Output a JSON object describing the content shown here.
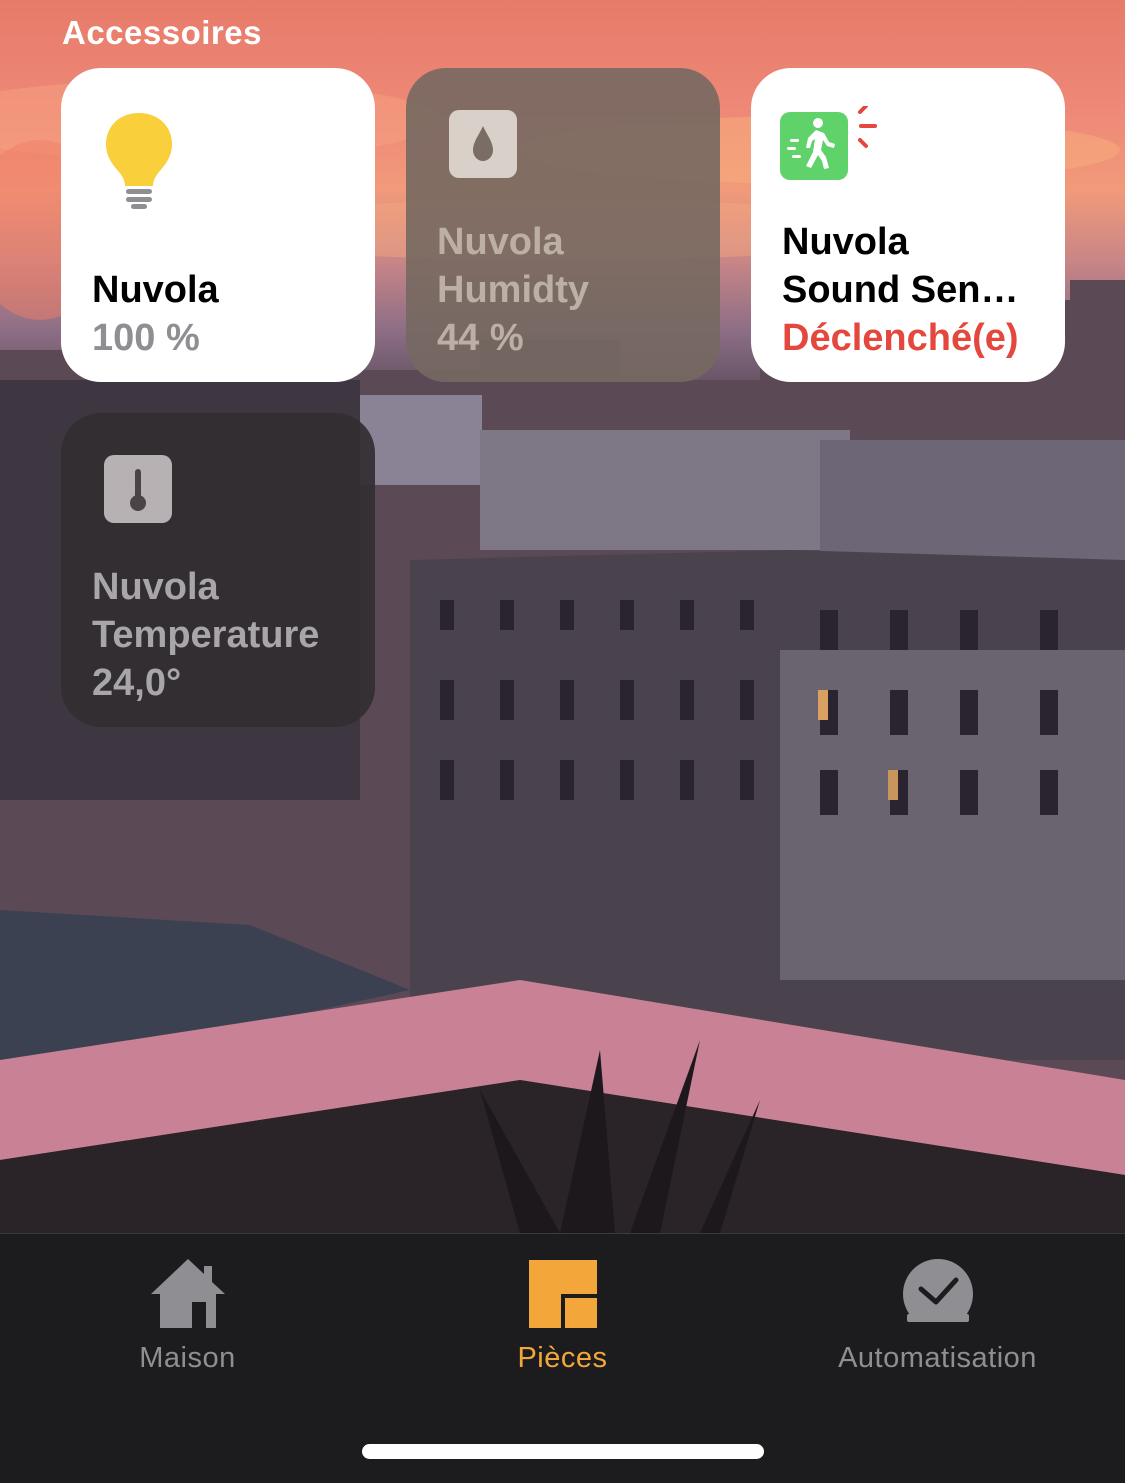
{
  "section_title": "Accessoires",
  "accessories": [
    {
      "line1": "Nuvola",
      "line2": "",
      "status": "100 %",
      "icon": "lightbulb-icon",
      "state": "on"
    },
    {
      "line1": "Nuvola",
      "line2": "Humidty",
      "status": "44 %",
      "icon": "humidity-drop-icon",
      "state": "off"
    },
    {
      "line1": "Nuvola",
      "line2": "Sound Sen…",
      "status": "Déclenché(e)",
      "icon": "motion-sensor-icon",
      "state": "triggered"
    },
    {
      "line1": "Nuvola",
      "line2": "Temperature",
      "status": "24,0°",
      "icon": "thermometer-icon",
      "state": "off"
    }
  ],
  "tabs": [
    {
      "label": "Maison",
      "icon": "house-icon",
      "active": false
    },
    {
      "label": "Pièces",
      "icon": "rooms-icon",
      "active": true
    },
    {
      "label": "Automatisation",
      "icon": "automation-clock-icon",
      "active": false
    }
  ],
  "colors": {
    "accent": "#f3a73b",
    "alert": "#e3473d",
    "bulb": "#f9cf3c",
    "sensor_green": "#5fd26a"
  }
}
